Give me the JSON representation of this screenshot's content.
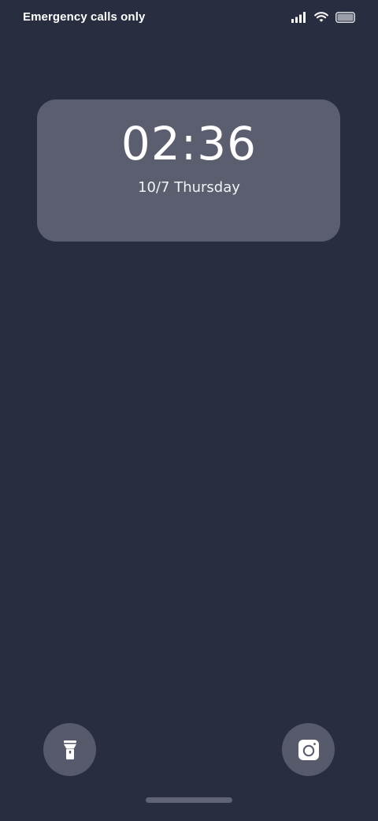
{
  "status_bar": {
    "carrier_text": "Emergency calls only",
    "icons": [
      "signal-icon",
      "wifi-icon",
      "battery-icon"
    ]
  },
  "clock_widget": {
    "time": "02:36",
    "date": "10/7 Thursday"
  },
  "shortcuts": {
    "left_icon": "flashlight-icon",
    "right_icon": "camera-icon"
  },
  "colors": {
    "background": "#292d40",
    "widget": "#5a5e6e",
    "shortcut_button": "#565a6b",
    "home_indicator": "#5f6375"
  }
}
